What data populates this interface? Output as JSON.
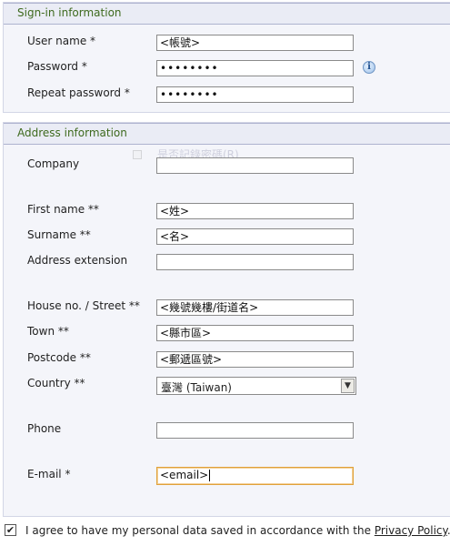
{
  "signin": {
    "title": "Sign-in information",
    "username_label": "User name *",
    "username_value": "<帳號>",
    "password_label": "Password *",
    "password_value": "••••••••",
    "repeat_password_label": "Repeat password *",
    "repeat_password_value": "••••••••",
    "info_icon_glyph": "i"
  },
  "address": {
    "title": "Address information",
    "ghost_text": "是否記錄密碼(R)",
    "company_label": "Company",
    "company_value": "",
    "firstname_label": "First name **",
    "firstname_value": "<姓>",
    "surname_label": "Surname **",
    "surname_value": "<名>",
    "extension_label": "Address extension",
    "extension_value": "",
    "street_label": "House no. / Street **",
    "street_value": "<幾號幾樓/街道名>",
    "town_label": "Town **",
    "town_value": "<縣市區>",
    "postcode_label": "Postcode **",
    "postcode_value": "<郵遞區號>",
    "country_label": "Country **",
    "country_value": "臺灣 (Taiwan)",
    "phone_label": "Phone",
    "phone_value": "",
    "email_label": "E-mail *",
    "email_value": "<email>"
  },
  "agree": {
    "checked": true,
    "text_before": "I agree to have my personal data saved in accordance with the ",
    "link": "Privacy Policy",
    "text_after": ". *"
  }
}
